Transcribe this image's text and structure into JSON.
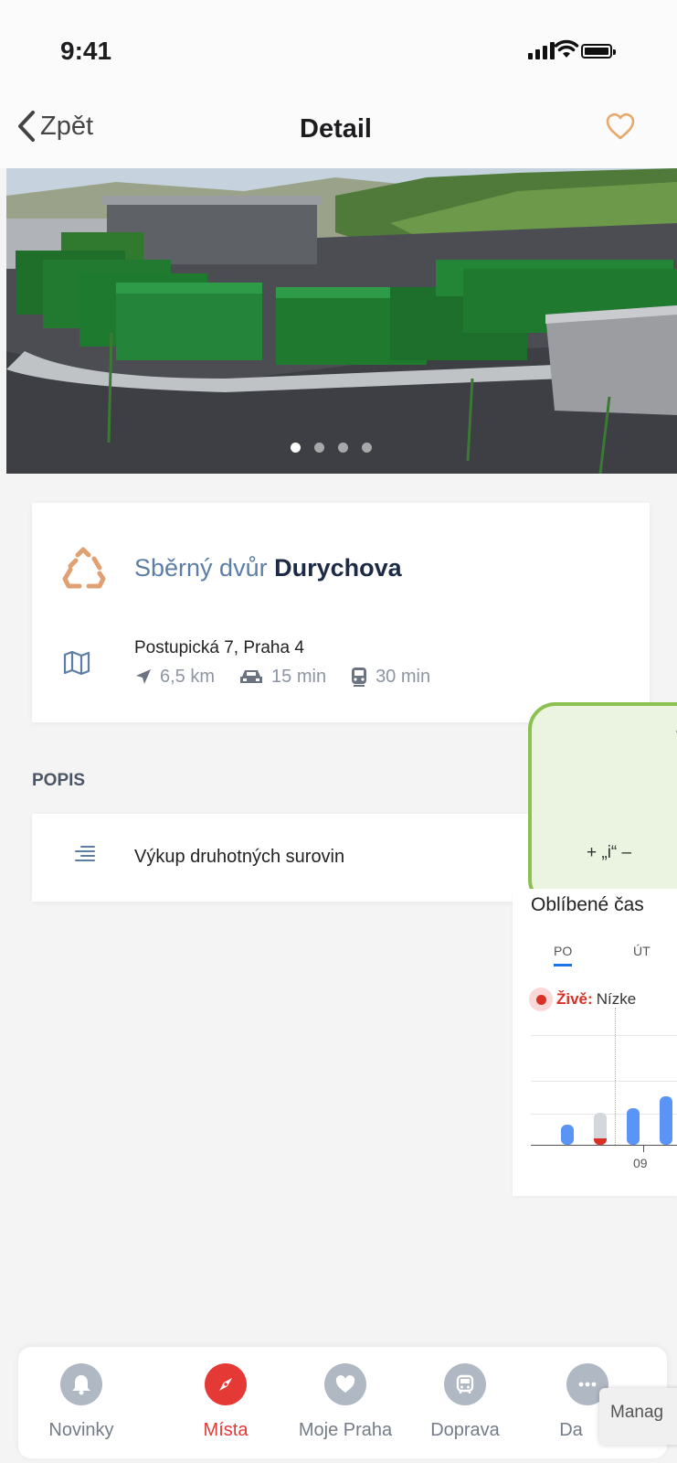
{
  "status": {
    "time": "9:41"
  },
  "nav": {
    "back_label": "Zpět",
    "title": "Detail"
  },
  "gallery": {
    "count": 4,
    "active": 0
  },
  "place": {
    "category": "Sběrný dvůr",
    "name": "Durychova",
    "address": "Postupická 7, Praha 4",
    "distance": "6,5 km",
    "car_time": "15 min",
    "transit_time": "30 min"
  },
  "description": {
    "section_label": "POPIS",
    "text": "Výkup druhotných surovin"
  },
  "note": {
    "top_text": "V",
    "text": "+ „i“ –"
  },
  "popular_times": {
    "title": "Oblíbené čas",
    "days": [
      "PO",
      "ÚT"
    ],
    "selected_day": "PO",
    "live_label": "Živě:",
    "live_text": "Nízke",
    "tick_label": "09",
    "colors": {
      "bar": "#5a95f5",
      "current_bar": "#d4d7dc",
      "live": "#d93025"
    }
  },
  "tabbar": {
    "items": [
      {
        "label": "Novinky",
        "icon": "bell-icon"
      },
      {
        "label": "Místa",
        "icon": "compass-icon"
      },
      {
        "label": "Moje Praha",
        "icon": "heart-icon"
      },
      {
        "label": "Doprava",
        "icon": "bus-icon"
      },
      {
        "label": "Da",
        "icon": "more-icon"
      }
    ],
    "active": "Místa"
  },
  "manage_button": "Manag",
  "colors": {
    "accent_red": "#e53935",
    "link_blue": "#5c7ea6",
    "note_border": "#8cc152"
  }
}
